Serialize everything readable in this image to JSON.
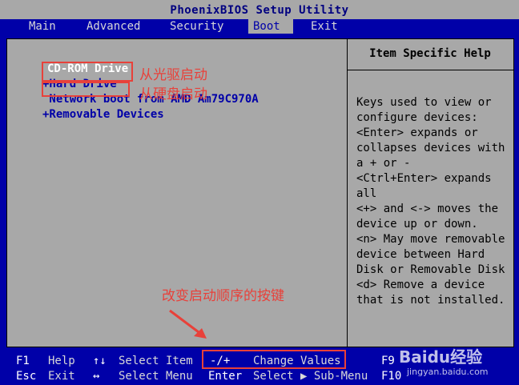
{
  "title": "PhoenixBIOS Setup Utility",
  "tabs": [
    {
      "label": "Main"
    },
    {
      "label": "Advanced"
    },
    {
      "label": "Security"
    },
    {
      "label": "Boot"
    },
    {
      "label": "Exit"
    }
  ],
  "active_tab": "Boot",
  "boot_items": [
    {
      "label": "CD-ROM Drive"
    },
    {
      "label": "+Hard Drive"
    },
    {
      "label": " Network boot from AMD Am79C970A"
    },
    {
      "label": "+Removable Devices"
    }
  ],
  "help": {
    "title": "Item Specific Help",
    "text": "Keys used to view or\nconfigure devices:\n<Enter> expands or\ncollapses devices with\na + or -\n<Ctrl+Enter> expands\nall\n<+> and <-> moves the\ndevice up or down.\n<n> May move removable\ndevice between Hard\nDisk or Removable Disk\n<d> Remove a device\nthat is not installed."
  },
  "annotations": {
    "cdrom": "从光驱启动",
    "hdd": "从硬盘启动",
    "keys": "改变启动顺序的按键"
  },
  "footer": {
    "f1_key": "F1",
    "f1_label": "Help",
    "updown_key": "↑↓",
    "updown_label": "Select Item",
    "change_key": "-/+",
    "change_label": "Change Values",
    "f9_key": "F9",
    "esc_key": "Esc",
    "esc_label": "Exit",
    "lr_key": "↔",
    "lr_label": "Select Menu",
    "enter_key": "Enter",
    "enter_label": "Select ▶ Sub-Menu",
    "f10_key": "F10"
  },
  "watermark": {
    "brand": "Baidu经验",
    "url": "jingyan.baidu.com"
  },
  "colors": {
    "bios_blue": "#0000a8",
    "bios_gray": "#a8a8a8",
    "annotation_red": "#e8413a"
  }
}
